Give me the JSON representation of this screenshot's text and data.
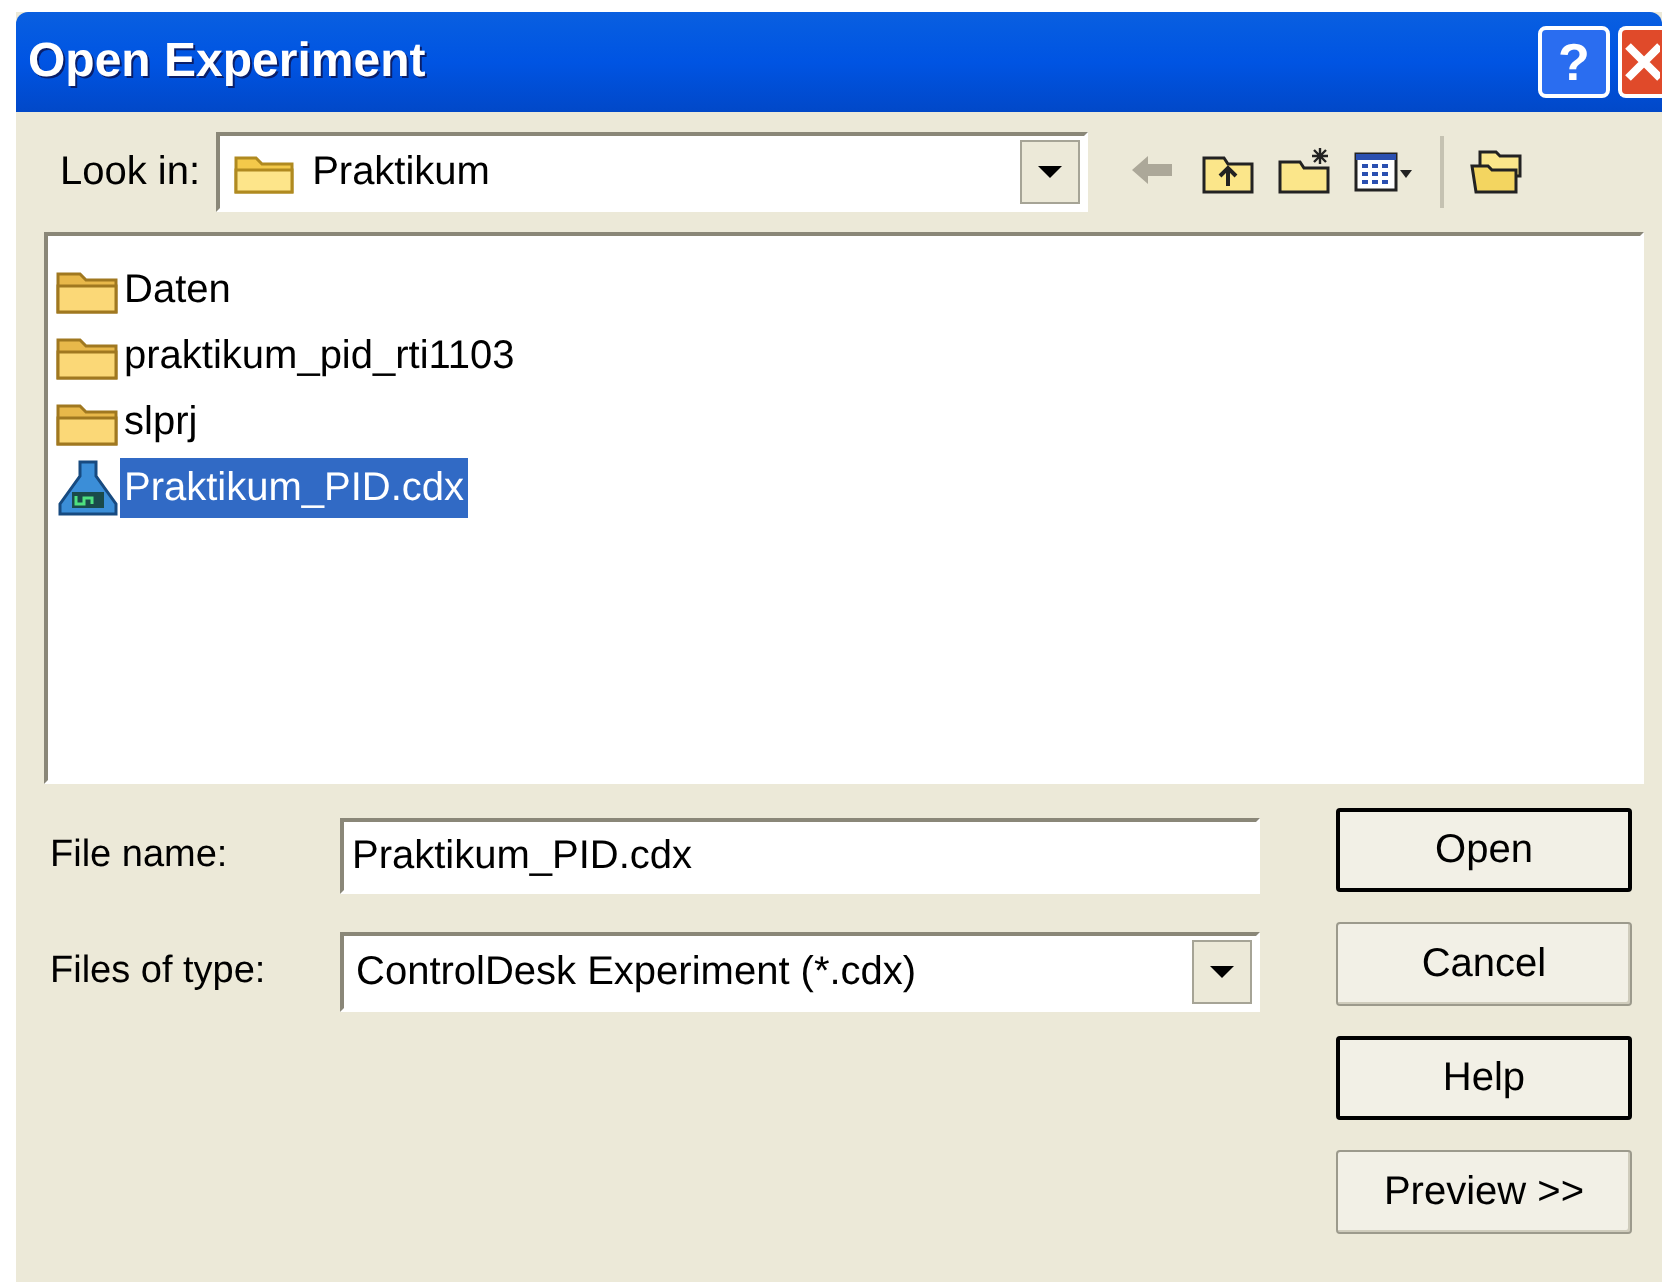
{
  "window": {
    "title": "Open Experiment",
    "title_buttons": [
      "?"
    ]
  },
  "look_in": {
    "label": "Look in:",
    "value": "Praktikum"
  },
  "toolbar": [
    {
      "kind": "back",
      "disabled": true
    },
    {
      "kind": "up",
      "disabled": false
    },
    {
      "kind": "new_folder",
      "disabled": false
    },
    {
      "kind": "views",
      "disabled": false
    },
    {
      "kind": "folders",
      "disabled": false
    }
  ],
  "files": [
    {
      "kind": "folder",
      "name": "Daten",
      "selected": false
    },
    {
      "kind": "folder",
      "name": "praktikum_pid_rti1103",
      "selected": false
    },
    {
      "kind": "folder",
      "name": "slprj",
      "selected": false
    },
    {
      "kind": "experiment",
      "name": "Praktikum_PID.cdx",
      "selected": true
    }
  ],
  "file_name": {
    "label": "File name:",
    "value": "Praktikum_PID.cdx"
  },
  "file_type": {
    "label": "Files of type:",
    "value": "ControlDesk Experiment (*.cdx)"
  },
  "buttons": [
    {
      "label": "Open",
      "emphasized": true
    },
    {
      "label": "Cancel",
      "emphasized": false
    },
    {
      "label": "Help",
      "emphasized": true
    },
    {
      "label": "Preview >>",
      "emphasized": false
    }
  ]
}
